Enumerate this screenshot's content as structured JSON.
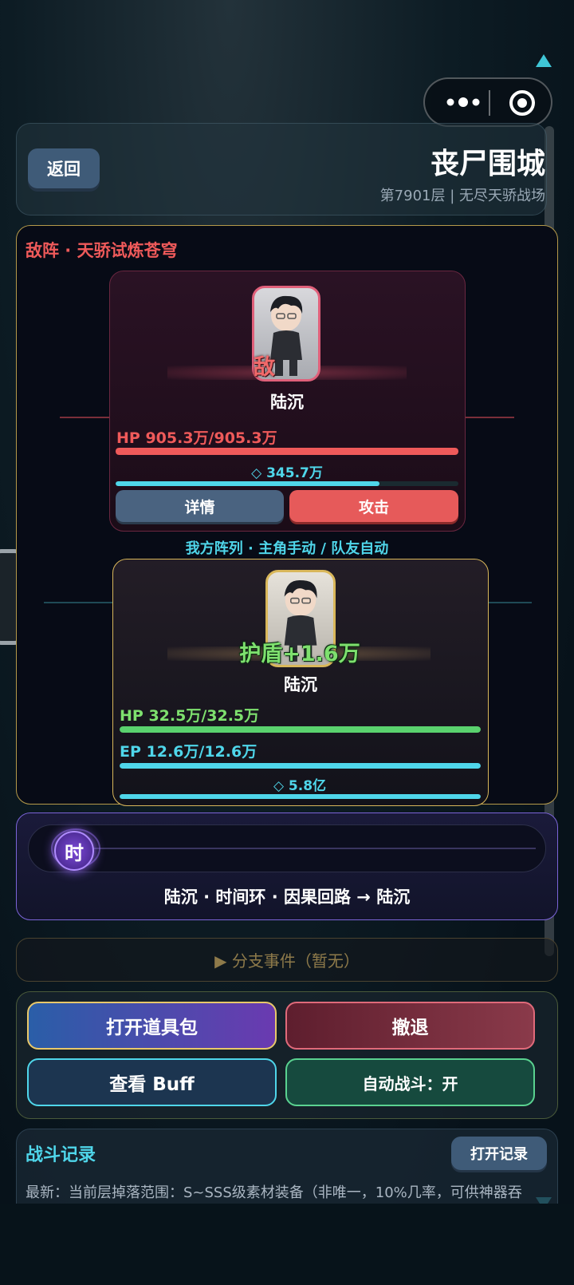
{
  "header": {
    "back_label": "返回",
    "title": "丧尸围城",
    "subtitle": "第7901层 | 无尽天骄战场"
  },
  "enemy": {
    "section_label": "敌阵 · 天骄试炼苍穹",
    "badge": "敌",
    "name": "陆沉",
    "hp_text": "HP 905.3万/905.3万",
    "hp_fraction": 1.0,
    "shield_text": "◇ 345.7万",
    "shield_fraction": 0.77,
    "detail_label": "详情",
    "attack_label": "攻击"
  },
  "ally": {
    "section_label": "我方阵列 · 主角手动 / 队友自动",
    "float_text": "护盾+1.6万",
    "name": "陆沉",
    "hp_text": "HP 32.5万/32.5万",
    "hp_fraction": 1.0,
    "ep_text": "EP 12.6万/12.6万",
    "ep_fraction": 1.0,
    "shield_text": "◇ 5.8亿",
    "shield_fraction": 1.0
  },
  "timeline": {
    "token_label": "时",
    "turn_text": "陆沉 · 时间环 · 因果回路 → 陆沉"
  },
  "branch": {
    "label": "▶ 分支事件（暂无）"
  },
  "actions": {
    "items_label": "打开道具包",
    "retreat_label": "撤退",
    "buff_label": "查看 Buff",
    "auto_label": "自动战斗：开"
  },
  "log": {
    "title": "战斗记录",
    "open_label": "打开记录",
    "latest": "最新：当前层掉落范围：S~SSS级素材装备（非唯一，10%几率，可供神器吞"
  },
  "capsule": {
    "more_icon": "more-dots-icon",
    "close_icon": "target-circle-icon"
  },
  "colors": {
    "enemy_red": "#ef5a5a",
    "ally_green": "#5ad26e",
    "cyan": "#4fd6ea",
    "gold": "#d9b75a",
    "purple": "#8b6cf0"
  }
}
